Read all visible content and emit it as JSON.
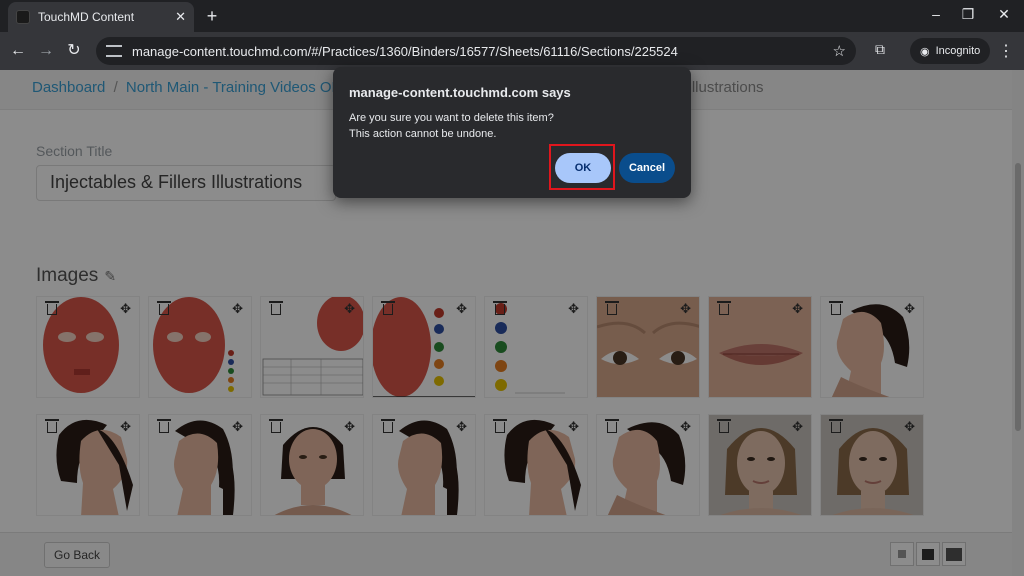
{
  "browser": {
    "tab_title": "TouchMD Content",
    "url": "manage-content.touchmd.com/#/Practices/1360/Binders/16577/Sheets/61116/Sections/225524",
    "incognito_label": "Incognito"
  },
  "breadcrumb": {
    "item1": "Dashboard",
    "item2": "North Main - Training Videos ONLY",
    "item_last": "s Illustrations"
  },
  "section": {
    "label": "Section Title",
    "value": "Injectables & Fillers Illustrations"
  },
  "images": {
    "title": "Images",
    "tiles": [
      {
        "kind": "face-muscles"
      },
      {
        "kind": "face-muscles-dots"
      },
      {
        "kind": "face-chart"
      },
      {
        "kind": "face-muscles-dots-large"
      },
      {
        "kind": "color-dots"
      },
      {
        "kind": "eyes"
      },
      {
        "kind": "lips"
      },
      {
        "kind": "profile-right"
      },
      {
        "kind": "profile-left"
      },
      {
        "kind": "three-quarter"
      },
      {
        "kind": "front"
      },
      {
        "kind": "three-quarter"
      },
      {
        "kind": "profile-left"
      },
      {
        "kind": "profile-right"
      },
      {
        "kind": "photo-front"
      },
      {
        "kind": "photo-front"
      }
    ]
  },
  "footer": {
    "go_back": "Go Back"
  },
  "dialog": {
    "title": "manage-content.touchmd.com says",
    "line1": "Are you sure you want to delete this item?",
    "line2": "This action cannot be undone.",
    "ok": "OK",
    "cancel": "Cancel"
  },
  "colors": {
    "link": "#3aa0d6",
    "ok_bg": "#a8c7fa",
    "cancel_bg": "#0a4d8c",
    "highlight": "#e0161d"
  }
}
